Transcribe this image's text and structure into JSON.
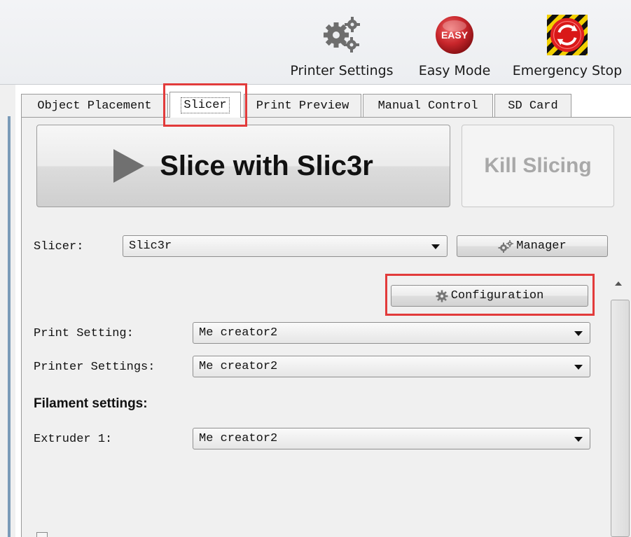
{
  "toolbar": {
    "printer_settings_label": "Printer Settings",
    "easy_mode_label": "Easy Mode",
    "easy_mode_badge": "EASY",
    "emergency_stop_label": "Emergency Stop"
  },
  "tabs": [
    {
      "label": "Object Placement"
    },
    {
      "label": "Slicer"
    },
    {
      "label": "Print Preview"
    },
    {
      "label": "Manual Control"
    },
    {
      "label": "SD Card"
    }
  ],
  "active_tab": "Slicer",
  "slicer_panel": {
    "slice_button_label": "Slice with Slic3r",
    "kill_button_label": "Kill Slicing",
    "slicer_label": "Slicer:",
    "slicer_value": "Slic3r",
    "manager_button_label": "Manager",
    "configuration_button_label": "Configuration",
    "print_setting_label": "Print Setting:",
    "print_setting_value": "Me creator2",
    "printer_settings_label": "Printer Settings:",
    "printer_settings_value": "Me creator2",
    "filament_heading": "Filament settings:",
    "extruder_label": "Extruder 1:",
    "extruder_value": "Me creator2"
  },
  "colors": {
    "highlight": "#e23b3b",
    "easy_badge": "#c8262b",
    "emergency_red": "#e02020",
    "hazard_yellow": "#f2d000"
  },
  "icons": [
    "gears-icon",
    "easy-mode-icon",
    "emergency-stop-icon",
    "play-icon",
    "gear-icon"
  ]
}
